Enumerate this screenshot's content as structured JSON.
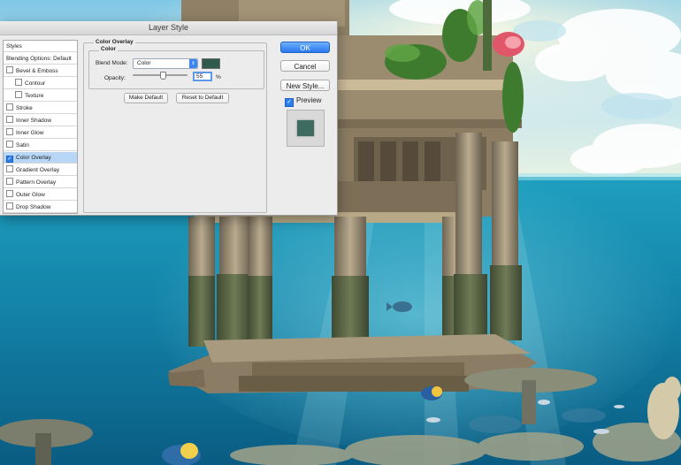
{
  "dialog": {
    "title": "Layer Style",
    "styles_list": [
      {
        "label": "Styles",
        "checkbox": false,
        "checked": false,
        "indent": false,
        "selected": false
      },
      {
        "label": "Blending Options: Default",
        "checkbox": false,
        "checked": false,
        "indent": false,
        "selected": false
      },
      {
        "label": "Bevel & Emboss",
        "checkbox": true,
        "checked": false,
        "indent": false,
        "selected": false
      },
      {
        "label": "Contour",
        "checkbox": true,
        "checked": false,
        "indent": true,
        "selected": false
      },
      {
        "label": "Texture",
        "checkbox": true,
        "checked": false,
        "indent": true,
        "selected": false
      },
      {
        "label": "Stroke",
        "checkbox": true,
        "checked": false,
        "indent": false,
        "selected": false
      },
      {
        "label": "Inner Shadow",
        "checkbox": true,
        "checked": false,
        "indent": false,
        "selected": false
      },
      {
        "label": "Inner Glow",
        "checkbox": true,
        "checked": false,
        "indent": false,
        "selected": false
      },
      {
        "label": "Satin",
        "checkbox": true,
        "checked": false,
        "indent": false,
        "selected": false
      },
      {
        "label": "Color Overlay",
        "checkbox": true,
        "checked": true,
        "indent": false,
        "selected": true
      },
      {
        "label": "Gradient Overlay",
        "checkbox": true,
        "checked": false,
        "indent": false,
        "selected": false
      },
      {
        "label": "Pattern Overlay",
        "checkbox": true,
        "checked": false,
        "indent": false,
        "selected": false
      },
      {
        "label": "Outer Glow",
        "checkbox": true,
        "checked": false,
        "indent": false,
        "selected": false
      },
      {
        "label": "Drop Shadow",
        "checkbox": true,
        "checked": false,
        "indent": false,
        "selected": false
      }
    ],
    "color_overlay": {
      "group_title": "Color Overlay",
      "subgroup_title": "Color",
      "blend_mode_label": "Blend Mode:",
      "blend_mode_value": "Color",
      "overlay_color": "#2f5a4e",
      "opacity_label": "Opacity:",
      "opacity_value": "55",
      "opacity_unit": "%",
      "opacity_percent": 55,
      "make_default_label": "Make Default",
      "reset_default_label": "Reset to Default"
    },
    "buttons": {
      "ok": "OK",
      "cancel": "Cancel",
      "new_style": "New Style..."
    },
    "preview": {
      "label": "Preview",
      "checked": true,
      "swatch_color": "#3d6b5f"
    }
  },
  "scene_icon": "underwater-temple-artwork"
}
